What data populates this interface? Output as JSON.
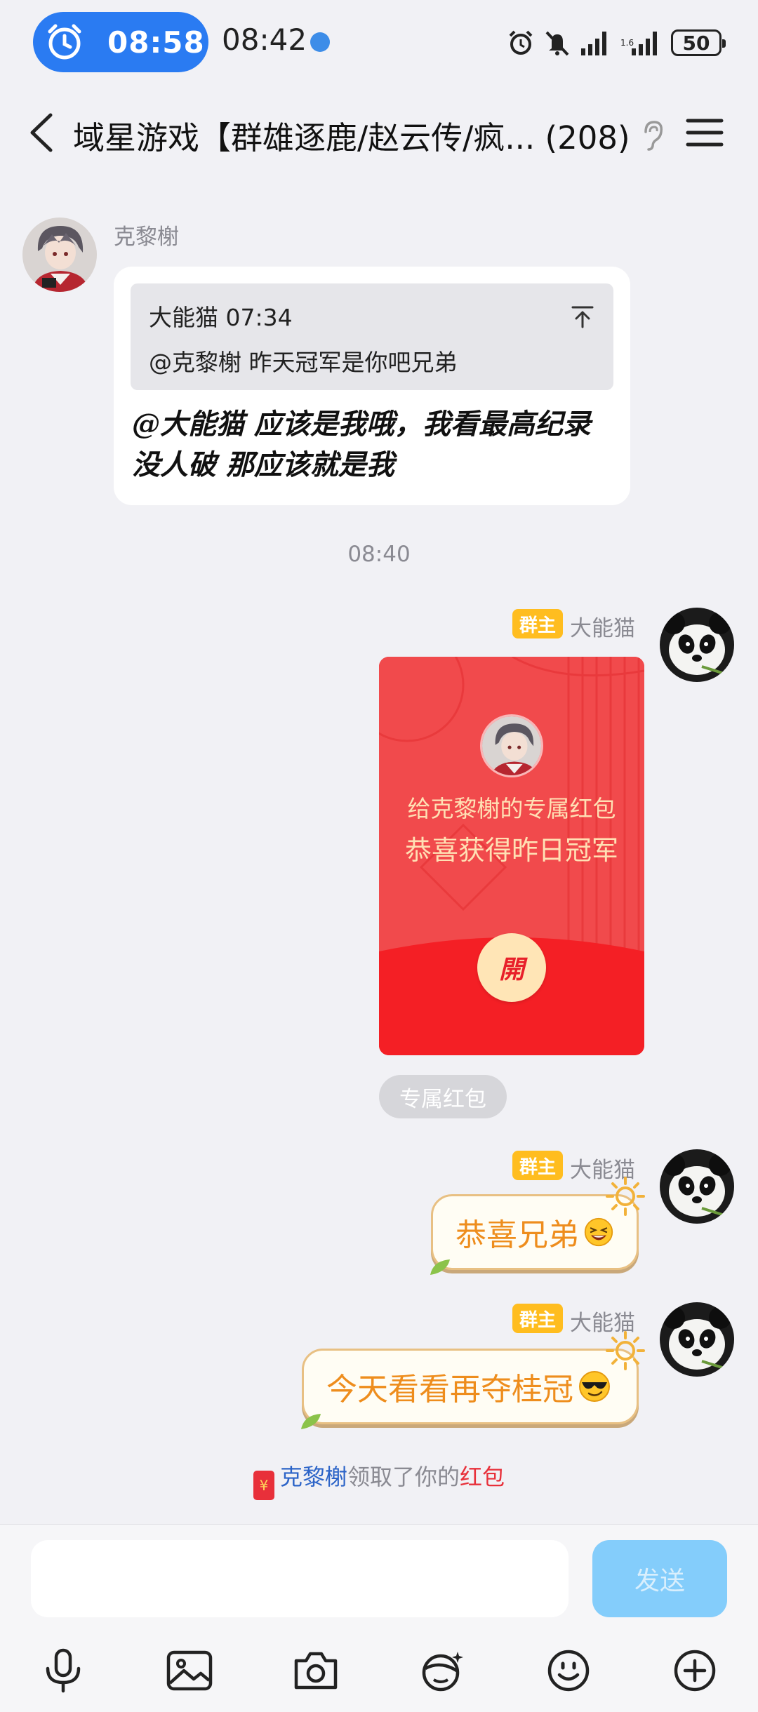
{
  "status_bar": {
    "alarm_time": "08:58",
    "system_time": "08:42",
    "battery": "50"
  },
  "header": {
    "title": "域星游戏【群雄逐鹿/赵云传/疯... (208)"
  },
  "messages": {
    "m1": {
      "sender": "克黎榭",
      "quote_header": "大能猫 07:34",
      "quote_text": "@克黎榭 昨天冠军是你吧兄弟",
      "text": "@大能猫 应该是我哦，我看最高纪录没人破 那应该就是我"
    },
    "time_sep": "08:40",
    "m2": {
      "badge": "群主",
      "sender": "大能猫",
      "red_packet_to": "给克黎榭的专属红包",
      "red_packet_msg": "恭喜获得昨日冠军",
      "open_label": "開",
      "tag": "专属红包"
    },
    "m3": {
      "badge": "群主",
      "sender": "大能猫",
      "text": "恭喜兄弟"
    },
    "m4": {
      "badge": "群主",
      "sender": "大能猫",
      "text": "今天看看再夺桂冠"
    },
    "notice": {
      "who": "克黎榭",
      "middle": "领取了你的",
      "item": "红包"
    }
  },
  "input": {
    "value": "",
    "send_label": "发送"
  },
  "icons": [
    "alarm-icon",
    "back-icon",
    "ear-icon",
    "menu-icon",
    "mic-icon",
    "image-icon",
    "camera-icon",
    "ai-face-icon",
    "emoji-icon",
    "plus-icon"
  ],
  "colors": {
    "accent_blue": "#2a7bf2",
    "red_packet": "#f14a4c",
    "owner_badge": "#ffbd1f",
    "theme_text": "#ee8d1d",
    "send_button": "#84cdfb"
  }
}
